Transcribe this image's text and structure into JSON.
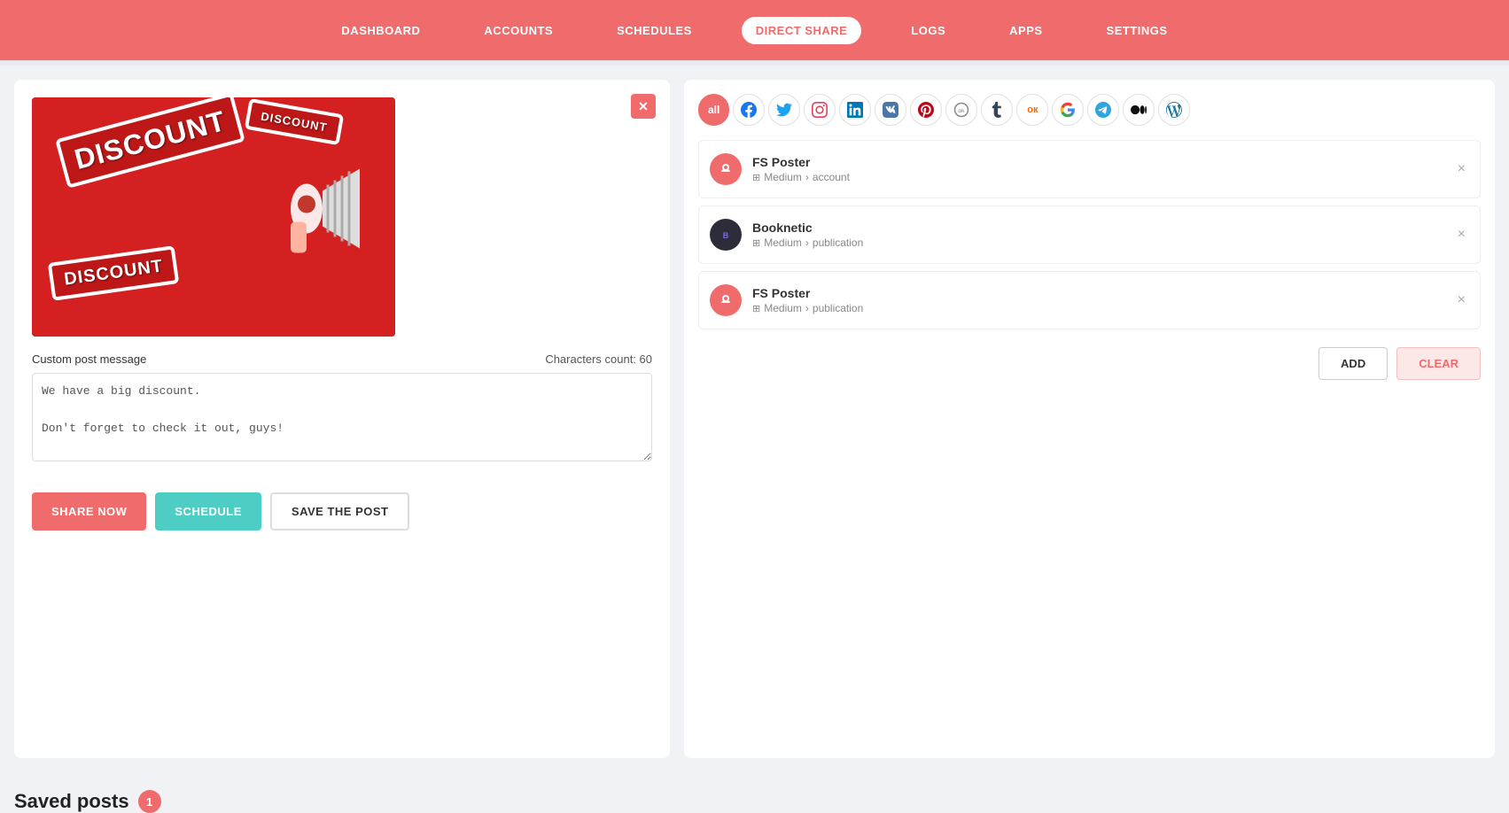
{
  "nav": {
    "items": [
      {
        "label": "DASHBOARD",
        "active": false
      },
      {
        "label": "ACCOUNTS",
        "active": false
      },
      {
        "label": "SCHEDULES",
        "active": false
      },
      {
        "label": "DIRECT SHARE",
        "active": true
      },
      {
        "label": "LOGS",
        "active": false
      },
      {
        "label": "APPS",
        "active": false
      },
      {
        "label": "SETTINGS",
        "active": false
      }
    ]
  },
  "left_panel": {
    "close_label": "✕",
    "message_label": "Custom post message",
    "chars_label": "Characters count: 60",
    "message_text": "We have a big discount.\n\nDon't forget to check it out, guys!",
    "message_placeholder": "We have a big discount.\n\nDon't forget to check it out, guys!",
    "buttons": {
      "share": "SHARE NOW",
      "schedule": "SCHEDULE",
      "save": "SAVE THE POST"
    }
  },
  "saved_posts": {
    "title": "Saved posts",
    "count": "1"
  },
  "right_panel": {
    "social_icons": [
      {
        "name": "all",
        "label": "all",
        "symbol": "all"
      },
      {
        "name": "facebook",
        "symbol": "f"
      },
      {
        "name": "twitter",
        "symbol": "𝕏"
      },
      {
        "name": "instagram",
        "symbol": "◎"
      },
      {
        "name": "linkedin",
        "symbol": "in"
      },
      {
        "name": "vk",
        "symbol": "vk"
      },
      {
        "name": "pinterest",
        "symbol": "𝒫"
      },
      {
        "name": "ok",
        "symbol": "⊙"
      },
      {
        "name": "tumblr",
        "symbol": "t"
      },
      {
        "name": "odnoklassniki",
        "symbol": "OK"
      },
      {
        "name": "google",
        "symbol": "G"
      },
      {
        "name": "telegram",
        "symbol": "✈"
      },
      {
        "name": "medium",
        "symbol": "M"
      },
      {
        "name": "wordpress",
        "symbol": "W"
      }
    ],
    "accounts": [
      {
        "name": "FS Poster",
        "platform": "Medium",
        "type": "account",
        "avatar_type": "red"
      },
      {
        "name": "Booknetic",
        "platform": "Medium",
        "type": "publication",
        "avatar_type": "dark"
      },
      {
        "name": "FS Poster",
        "platform": "Medium",
        "type": "publication",
        "avatar_type": "red"
      }
    ],
    "buttons": {
      "add": "ADD",
      "clear": "CLEAR"
    }
  }
}
